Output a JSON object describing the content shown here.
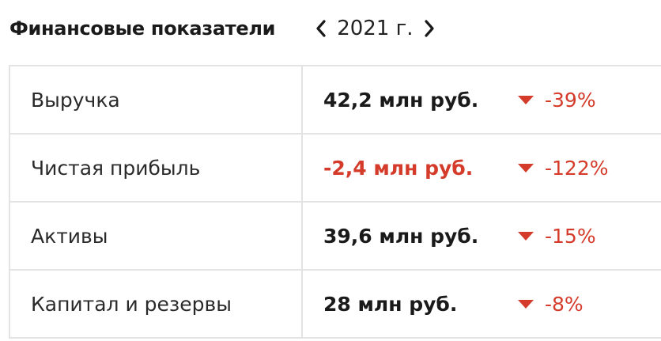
{
  "header": {
    "title": "Финансовые показатели",
    "year": "2021 г."
  },
  "colors": {
    "negative": "#d43b2a",
    "border": "#e3e3e3"
  },
  "icons": {
    "prev": "chevron-left-icon",
    "next": "chevron-right-icon",
    "decrease": "triangle-down-icon"
  },
  "rows": [
    {
      "label": "Выручка",
      "value": "42,2 млн руб.",
      "change": "-39%"
    },
    {
      "label": "Чистая прибыль",
      "value": "-2,4 млн руб.",
      "change": "-122%"
    },
    {
      "label": "Активы",
      "value": "39,6 млн руб.",
      "change": "-15%"
    },
    {
      "label": "Капитал и резервы",
      "value": "28 млн руб.",
      "change": "-8%"
    }
  ]
}
